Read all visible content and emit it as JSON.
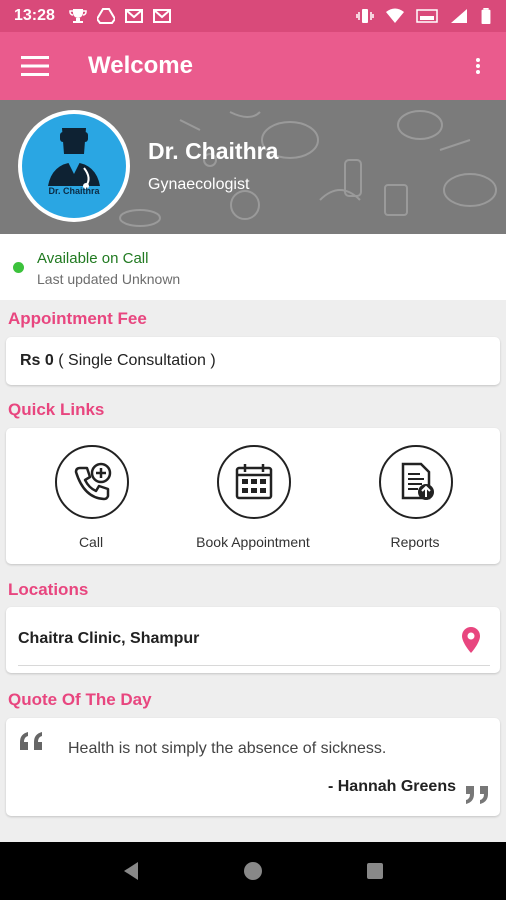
{
  "status_bar": {
    "time": "13:28",
    "icons_left": [
      "trophy-icon",
      "drive-icon",
      "gmail-icon",
      "gmail-icon"
    ],
    "icons_right": [
      "vibrate-icon",
      "wifi-icon",
      "volte-icon",
      "signal-icon",
      "battery-icon"
    ]
  },
  "app_bar": {
    "title": "Welcome",
    "menu_icon": "hamburger-menu-icon",
    "overflow_icon": "more-vert-icon",
    "color": "#ea5b8d"
  },
  "doctor": {
    "avatar_caption": "Dr. Chaithra",
    "name": "Dr. Chaithra",
    "specialty": "Gynaecologist"
  },
  "availability": {
    "status": "Available on Call",
    "last_updated": "Last updated Unknown",
    "status_color": "#3cc23c"
  },
  "appointment_fee": {
    "section_title": "Appointment Fee",
    "amount": "Rs 0",
    "detail": " ( Single Consultation )"
  },
  "quick_links": {
    "section_title": "Quick Links",
    "items": [
      {
        "label": "Call",
        "icon": "phone-add-icon"
      },
      {
        "label": "Book Appointment",
        "icon": "calendar-icon"
      },
      {
        "label": "Reports",
        "icon": "report-upload-icon"
      }
    ]
  },
  "locations": {
    "section_title": "Locations",
    "items": [
      {
        "name": "Chaitra Clinic, Shampur",
        "icon": "location-pin-icon"
      }
    ]
  },
  "quote": {
    "section_title": "Quote Of The Day",
    "text": "Health is not simply the absence of sickness.",
    "author": "- Hannah Greens"
  },
  "accent_color": "#e8467f",
  "nav_bar": {
    "buttons": [
      "back-icon",
      "home-icon",
      "recents-icon"
    ]
  }
}
